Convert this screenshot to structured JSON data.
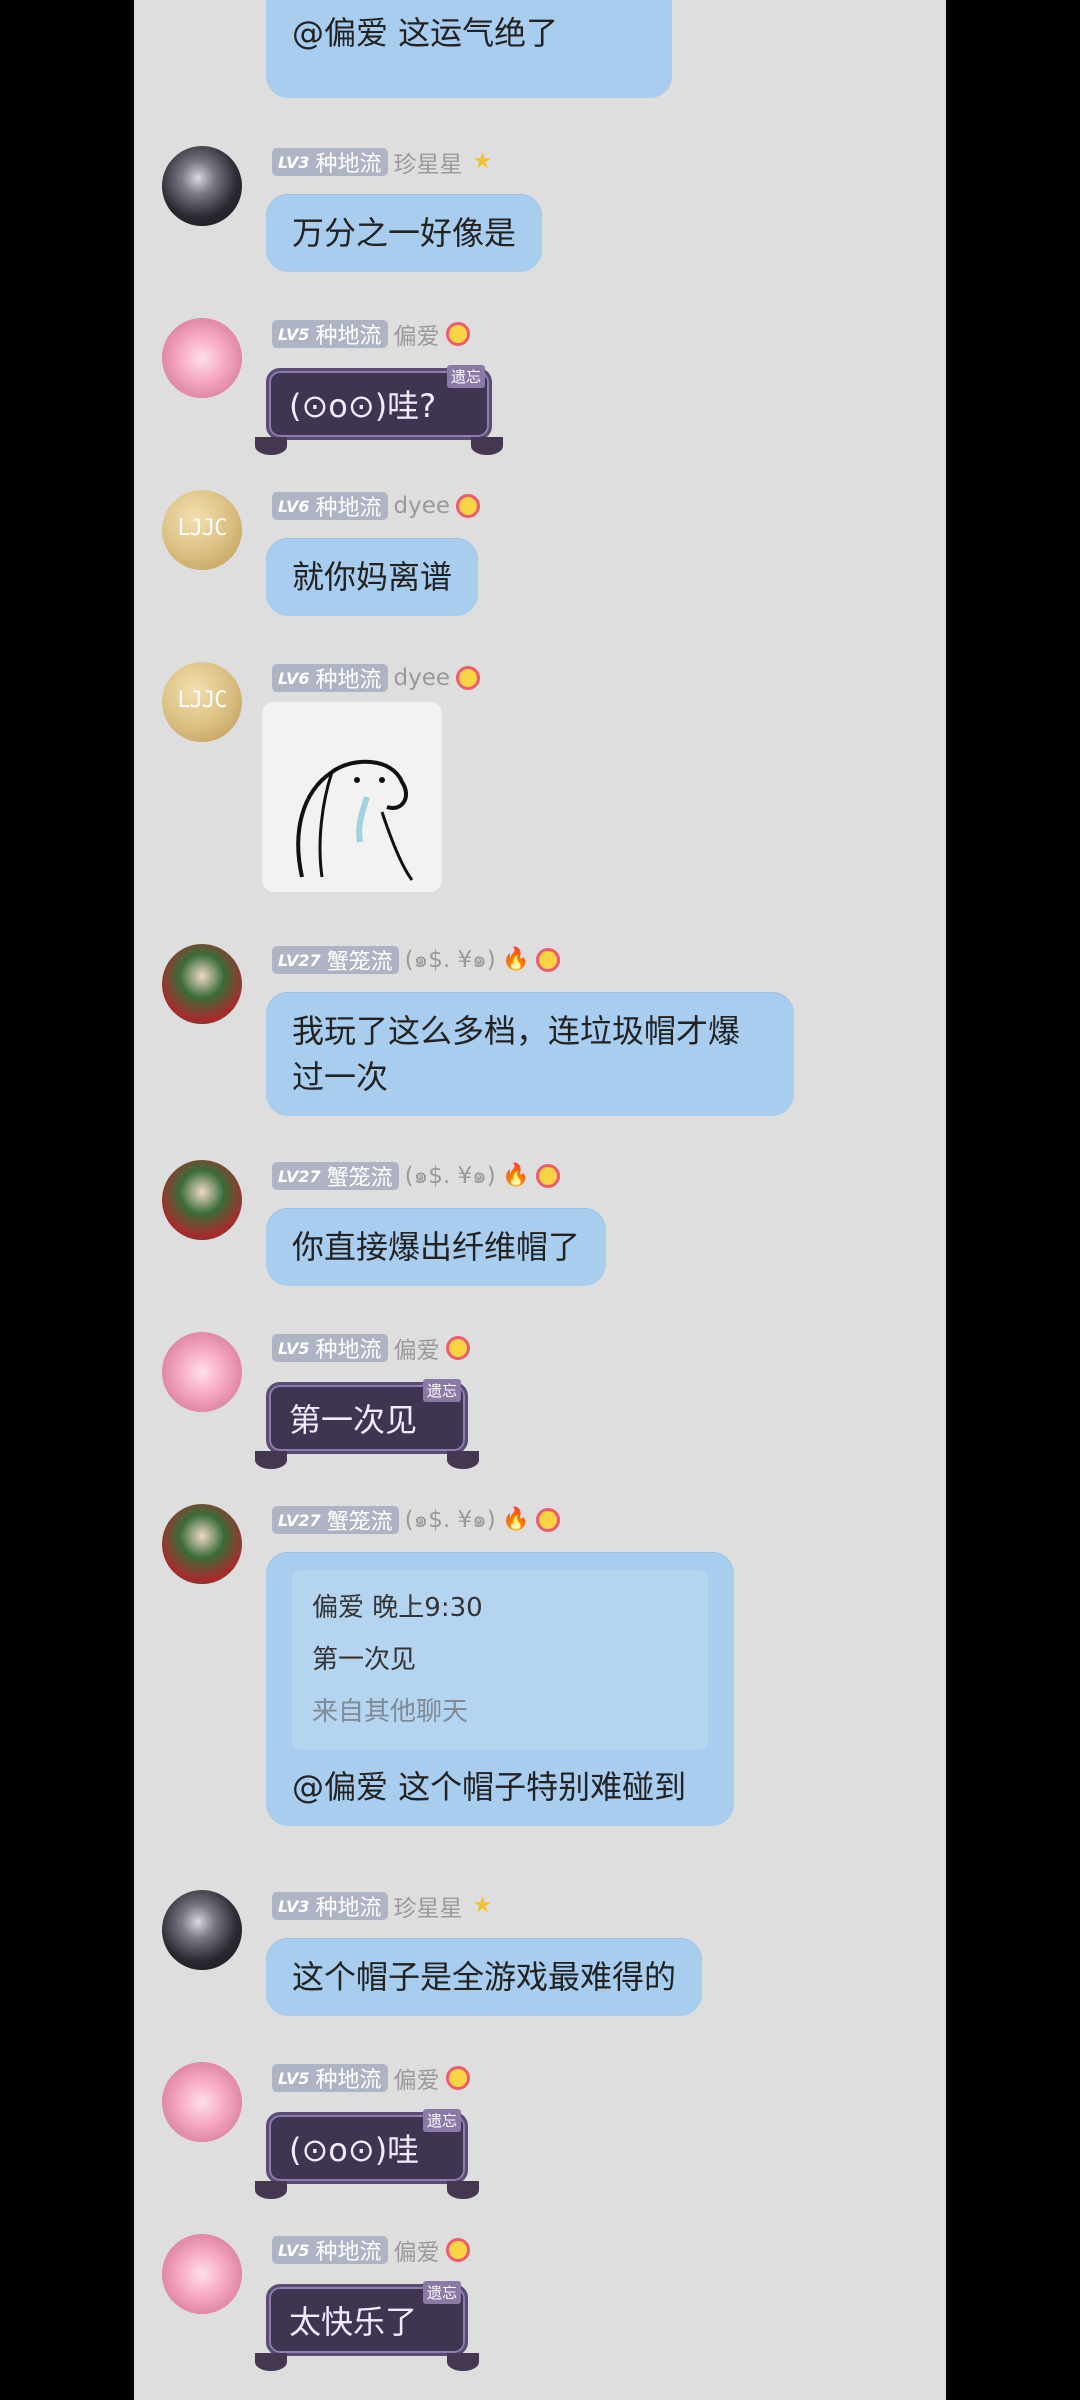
{
  "messages": [
    {
      "type": "text-partial",
      "text": "@偏爱 这运气绝了"
    },
    {
      "type": "text",
      "level": "LV3",
      "group": "种地流",
      "user": "珍星星",
      "icon": "star-icon",
      "text": "万分之一好像是"
    },
    {
      "type": "sticker-text",
      "level": "LV5",
      "group": "种地流",
      "user": "偏爱",
      "icon": "smile-badge-icon",
      "tag": "遗忘",
      "text": "(⊙o⊙)哇?"
    },
    {
      "type": "text",
      "level": "LV6",
      "group": "种地流",
      "user": "dyee",
      "icon": "smile-badge-icon",
      "text": "就你妈离谱"
    },
    {
      "type": "image",
      "level": "LV6",
      "group": "种地流",
      "user": "dyee",
      "icon": "smile-badge-icon"
    },
    {
      "type": "text",
      "level": "LV27",
      "group": "蟹笼流",
      "user": "(๑$. ¥๑)",
      "icon": "fire-icon",
      "text": "我玩了这么多档，连垃圾帽才爆过一次"
    },
    {
      "type": "text",
      "level": "LV27",
      "group": "蟹笼流",
      "user": "(๑$. ¥๑)",
      "icon": "fire-icon",
      "text": "你直接爆出纤维帽了"
    },
    {
      "type": "sticker-text",
      "level": "LV5",
      "group": "种地流",
      "user": "偏爱",
      "icon": "smile-badge-icon",
      "tag": "遗忘",
      "text": "第一次见"
    },
    {
      "type": "quote",
      "level": "LV27",
      "group": "蟹笼流",
      "user": "(๑$. ¥๑)",
      "icon": "fire-icon",
      "quote": {
        "author": "偏爱",
        "time": "晚上9:30",
        "text": "第一次见",
        "source": "来自其他聊天"
      },
      "text": "@偏爱 这个帽子特别难碰到"
    },
    {
      "type": "text",
      "level": "LV3",
      "group": "种地流",
      "user": "珍星星",
      "icon": "star-icon",
      "text": "这个帽子是全游戏最难得的"
    },
    {
      "type": "sticker-text",
      "level": "LV5",
      "group": "种地流",
      "user": "偏爱",
      "icon": "smile-badge-icon",
      "tag": "遗忘",
      "text": "(⊙o⊙)哇"
    },
    {
      "type": "sticker-text",
      "level": "LV5",
      "group": "种地流",
      "user": "偏爱",
      "icon": "smile-badge-icon",
      "tag": "遗忘",
      "text": "太快乐了"
    }
  ],
  "avatars": {
    "dyee": "LJJC"
  }
}
